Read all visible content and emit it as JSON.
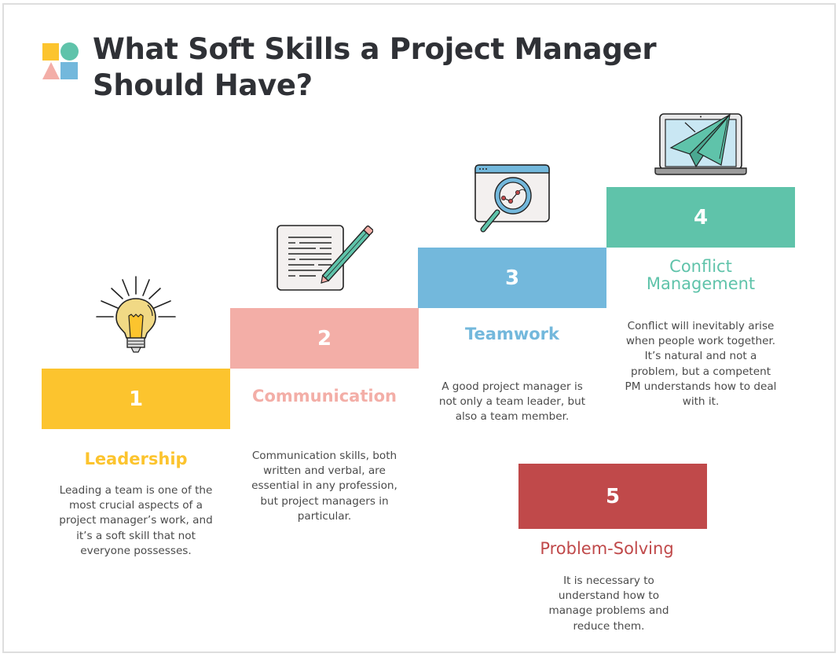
{
  "title": "What Soft Skills a Project Manager Should Have?",
  "colors": {
    "title": "#2f3136",
    "text": "#4a4a4a",
    "yellow": "#fcc42e",
    "pink": "#f3aea7",
    "blue": "#73b8dc",
    "teal": "#5fc3aa",
    "red": "#c0494a",
    "border": "#dedede"
  },
  "logo": {
    "shapes": [
      "yellow-square",
      "teal-circle",
      "pink-triangle",
      "blue-square"
    ]
  },
  "steps": [
    {
      "number": "1",
      "heading": "Leadership",
      "icon": "lightbulb-icon",
      "color": "#fcc42e",
      "description": "Leading a team is one of the most crucial aspects of a project manager’s work, and it’s a soft skill that not everyone possesses."
    },
    {
      "number": "2",
      "heading": "Communication",
      "icon": "document-pencil-icon",
      "color": "#f3aea7",
      "description": "Communication skills, both written and verbal, are essential in any profession, but project managers in particular."
    },
    {
      "number": "3",
      "heading": "Teamwork",
      "icon": "browser-magnifier-icon",
      "color": "#73b8dc",
      "description": "A good project manager is not only a team leader, but also a team member."
    },
    {
      "number": "4",
      "heading": "Conflict Management",
      "icon": "laptop-paper-plane-icon",
      "color": "#5fc3aa",
      "description": "Conflict will inevitably arise when people work together. It’s natural and not a problem, but a competent PM understands how to deal with it."
    },
    {
      "number": "5",
      "heading": "Problem-Solving",
      "icon": "",
      "color": "#c0494a",
      "description": "It is necessary to understand how to manage problems and reduce them."
    }
  ]
}
